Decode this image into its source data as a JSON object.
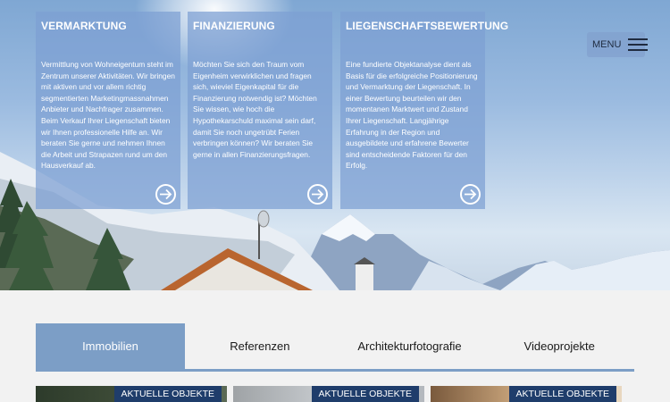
{
  "cards": [
    {
      "title": "VERMARKTUNG",
      "text": "Vermittlung von Wohneigentum steht im Zentrum unserer Aktivitäten. Wir bringen mit aktiven  und vor allem richtig segmentierten Marketingmassnahmen Anbieter und Nachfrager zusammen. Beim Verkauf Ihrer Liegenschaft bieten wir Ihnen professionelle Hilfe an. Wir beraten Sie gerne und nehmen Ihnen die Arbeit und Strapazen rund um den Hausverkauf ab.",
      "icon": "arrow-right-circle-icon"
    },
    {
      "title": "FINANZIERUNG",
      "text": "Möchten Sie sich den Traum vom Eigenheim verwirklichen und fragen sich, wieviel Eigenkapital für die Finanzierung notwendig ist? Möchten Sie wissen, wie hoch die Hypothekarschuld maximal sein darf, damit Sie noch ungetrübt Ferien verbringen können? Wir beraten Sie gerne in allen Finanzierungsfragen.",
      "icon": "arrow-right-circle-icon"
    },
    {
      "title": "LIEGENSCHAFTSBEWERTUNG",
      "text": "Eine fundierte Objektanalyse dient als Basis für die erfolgreiche Positionierung und Vermarktung der Liegenschaft. In einer Bewertung beurteilen wir den momentanen Marktwert und Zustand Ihrer Liegenschaft. Langjährige Erfahrung in der Region und ausgebildete und erfahrene Bewerter sind entscheidende Faktoren für den Erfolg.",
      "icon": "arrow-right-circle-icon"
    }
  ],
  "menu": {
    "label": "MENU",
    "icon": "hamburger-icon"
  },
  "tabs": [
    {
      "label": "Immobilien",
      "active": true
    },
    {
      "label": "Referenzen",
      "active": false
    },
    {
      "label": "Architekturfotografie",
      "active": false
    },
    {
      "label": "Videoprojekte",
      "active": false
    }
  ],
  "listings": [
    {
      "badge": "AKTUELLE OBJEKTE"
    },
    {
      "badge": "AKTUELLE OBJEKTE"
    },
    {
      "badge": "AKTUELLE OBJEKTE"
    }
  ],
  "colors": {
    "accent": "#7c9ec6",
    "card_bg": "rgba(125,160,210,0.72)",
    "badge_bg": "#1f3d6b",
    "section_bg": "#f2f2f2"
  }
}
